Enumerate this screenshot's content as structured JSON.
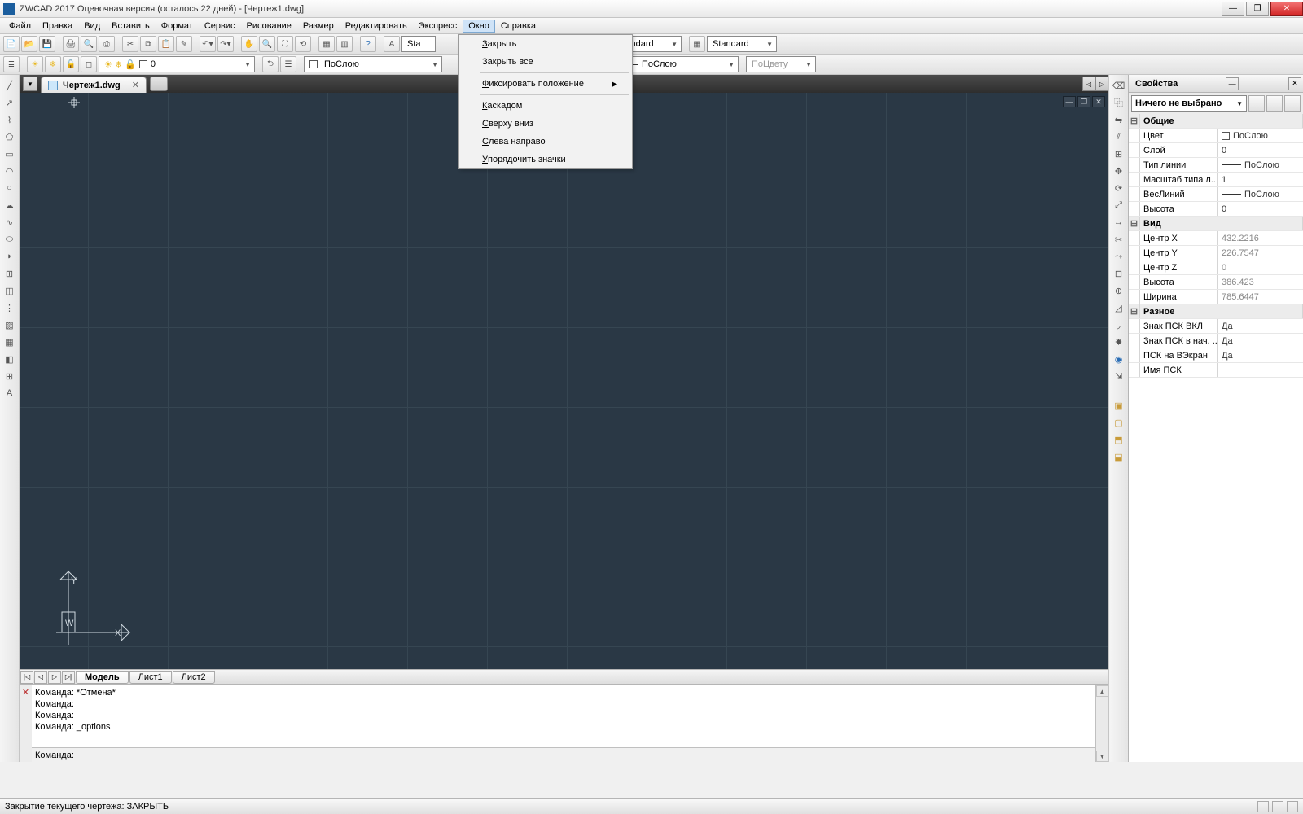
{
  "title": "ZWCAD 2017 Оценочная версия (осталось 22 дней) - [Чертеж1.dwg]",
  "menubar": [
    "Файл",
    "Правка",
    "Вид",
    "Вставить",
    "Формат",
    "Сервис",
    "Рисование",
    "Размер",
    "Редактировать",
    "Экспресс",
    "Окно",
    "Справка"
  ],
  "active_menu_index": 10,
  "combo1": "Standard",
  "combo2": "Standard",
  "layer_combo": "0",
  "linetype_combo": "ПоСлою",
  "lineweight_combo": "ПоСлою",
  "color_combo": "ПоЦвету",
  "file_tab": "Чертеж1.dwg",
  "layout_tabs": [
    "Модель",
    "Лист1",
    "Лист2"
  ],
  "active_layout": 0,
  "cmd_history": [
    "Команда: *Отмена*",
    "Команда:",
    "Команда:",
    "Команда: _options",
    ""
  ],
  "cmd_prompt": "Команда:",
  "statusbar_text": "Закрытие текущего чертежа:  ЗАКРЫТЬ",
  "dropdown": {
    "items": [
      {
        "label": "Закрыть",
        "u": 0
      },
      {
        "label": "Закрыть все"
      },
      {
        "sep": true
      },
      {
        "label": "Фиксировать положение",
        "u": 0,
        "sub": true
      },
      {
        "sep": true
      },
      {
        "label": "Каскадом",
        "u": 0
      },
      {
        "label": "Сверху вниз",
        "u": 0
      },
      {
        "label": "Слева направо",
        "u": 0
      },
      {
        "label": "Упорядочить значки",
        "u": 0
      }
    ]
  },
  "props": {
    "title": "Свойства",
    "selector": "Ничего не выбрано",
    "groups": [
      {
        "name": "Общие",
        "rows": [
          {
            "k": "Цвет",
            "v": "ПоСлою",
            "swatch": true
          },
          {
            "k": "Слой",
            "v": "0"
          },
          {
            "k": "Тип линии",
            "v": "ПоСлою",
            "line": true
          },
          {
            "k": "Масштаб типа л...",
            "v": "1"
          },
          {
            "k": "ВесЛиний",
            "v": "ПоСлою",
            "line": true
          },
          {
            "k": "Высота",
            "v": "0"
          }
        ]
      },
      {
        "name": "Вид",
        "rows": [
          {
            "k": "Центр X",
            "v": "432.2216",
            "ro": true
          },
          {
            "k": "Центр Y",
            "v": "226.7547",
            "ro": true
          },
          {
            "k": "Центр Z",
            "v": "0",
            "ro": true
          },
          {
            "k": "Высота",
            "v": "386.423",
            "ro": true
          },
          {
            "k": "Ширина",
            "v": "785.6447",
            "ro": true
          }
        ]
      },
      {
        "name": "Разное",
        "rows": [
          {
            "k": "Знак ПСК ВКЛ",
            "v": "Да"
          },
          {
            "k": "Знак ПСК в нач. ...",
            "v": "Да"
          },
          {
            "k": "ПСК на ВЭкран",
            "v": "Да"
          },
          {
            "k": "Имя ПСК",
            "v": ""
          }
        ]
      }
    ]
  }
}
